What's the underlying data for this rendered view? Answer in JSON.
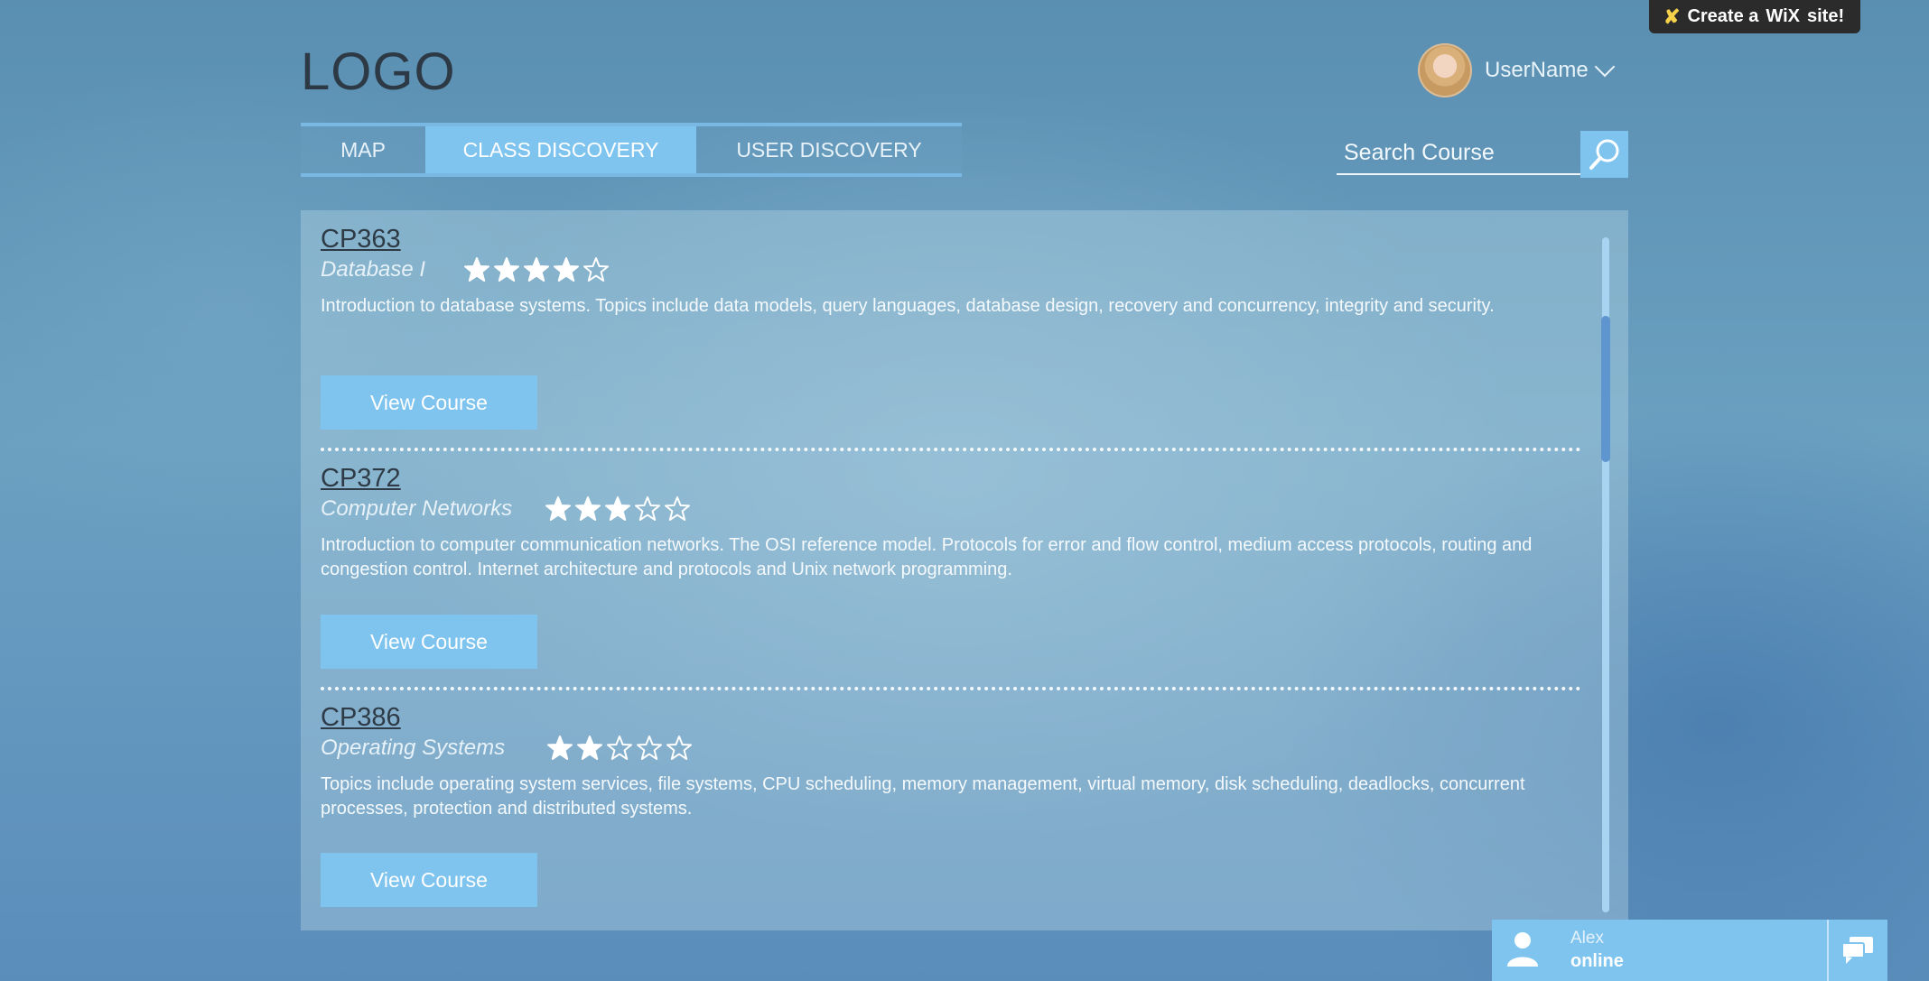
{
  "wix_badge": {
    "prefix": "Create a",
    "brand": "WiX",
    "suffix": "site!"
  },
  "header": {
    "logo": "LOGO",
    "username": "UserName"
  },
  "tabs": [
    {
      "label": "MAP",
      "active": false
    },
    {
      "label": "CLASS DISCOVERY",
      "active": true
    },
    {
      "label": "USER DISCOVERY",
      "active": false
    }
  ],
  "search": {
    "placeholder": "Search Course",
    "value": ""
  },
  "courses": [
    {
      "code": "CP363",
      "name": "Database I",
      "rating": 4,
      "max_rating": 5,
      "description": "Introduction to database systems. Topics include data models, query languages, database design, recovery and concurrency, integrity and security.",
      "button": "View Course"
    },
    {
      "code": "CP372",
      "name": "Computer Networks",
      "rating": 3,
      "max_rating": 5,
      "description": "Introduction to computer communication networks. The OSI reference model. Protocols for error and flow control, medium access protocols, routing and congestion control. Internet architecture and protocols and Unix network programming.",
      "button": "View Course"
    },
    {
      "code": "CP386",
      "name": "Operating Systems",
      "rating": 2,
      "max_rating": 5,
      "description": "Topics include operating system services, file systems, CPU scheduling, memory management, virtual memory, disk scheduling, deadlocks, concurrent processes, protection and distributed systems.",
      "button": "View Course"
    }
  ],
  "chat": {
    "name": "Alex",
    "status": "online"
  },
  "colors": {
    "accent": "#7ec4ee",
    "tab_border": "#78b8e2",
    "text_dark": "#2e3b46"
  }
}
